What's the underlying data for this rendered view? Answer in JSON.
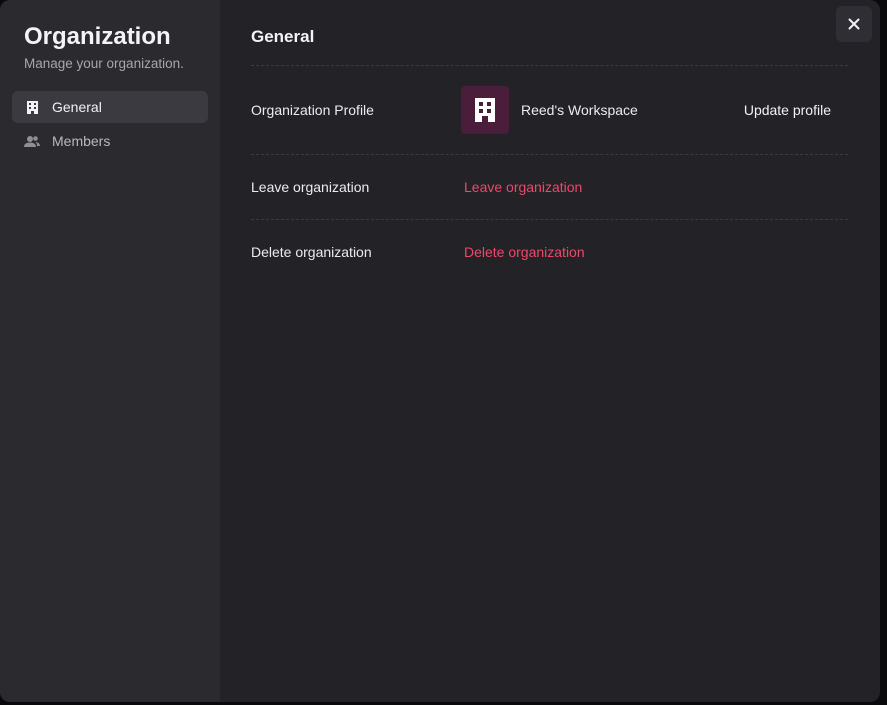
{
  "sidebar": {
    "title": "Organization",
    "subtitle": "Manage your organization.",
    "items": [
      {
        "label": "General",
        "icon": "building-icon",
        "active": true
      },
      {
        "label": "Members",
        "icon": "users-icon",
        "active": false
      }
    ]
  },
  "main": {
    "title": "General",
    "profile": {
      "label": "Organization Profile",
      "org_name": "Reed's Workspace",
      "update_label": "Update profile"
    },
    "leave": {
      "label": "Leave organization",
      "action_label": "Leave organization"
    },
    "delete": {
      "label": "Delete organization",
      "action_label": "Delete organization"
    }
  },
  "colors": {
    "danger": "#f2466a",
    "avatar_bg": "#4a1e3a",
    "sidebar_bg": "#2a2a2f",
    "main_bg": "#222227"
  },
  "icons": {
    "close": "close-icon"
  }
}
